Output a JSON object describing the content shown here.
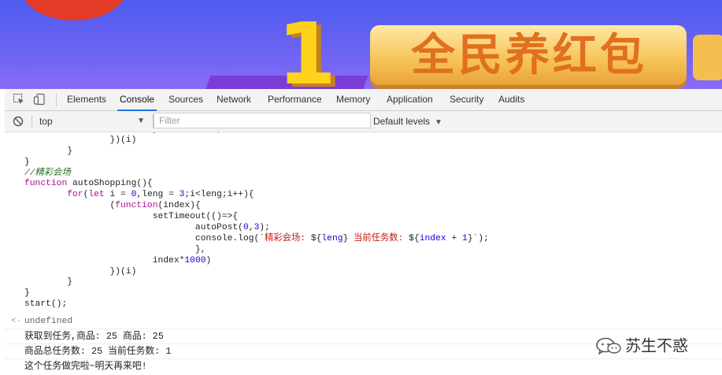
{
  "banner": {
    "number": "1",
    "title": "全民养红包"
  },
  "devtools": {
    "tabs": [
      {
        "label": "Elements",
        "active": false
      },
      {
        "label": "Console",
        "active": true
      },
      {
        "label": "Sources",
        "active": false
      },
      {
        "label": "Network",
        "active": false
      },
      {
        "label": "Performance",
        "active": false
      },
      {
        "label": "Memory",
        "active": false
      },
      {
        "label": "Application",
        "active": false
      },
      {
        "label": "Security",
        "active": false
      },
      {
        "label": "Audits",
        "active": false
      }
    ],
    "accent_color": "#1a73e8"
  },
  "toolbar": {
    "context": "top",
    "filter_placeholder": "Filter",
    "levels": "Default levels"
  },
  "console": {
    "return_value": "undefined",
    "logs": [
      "获取到任务,商品: 25 商品: 25",
      "商品总任务数: 25 当前任务数: 1",
      "这个任务做完啦~明天再来吧!"
    ]
  },
  "watermark": {
    "text": "苏生不惑",
    "icon": "wechat-icon"
  }
}
